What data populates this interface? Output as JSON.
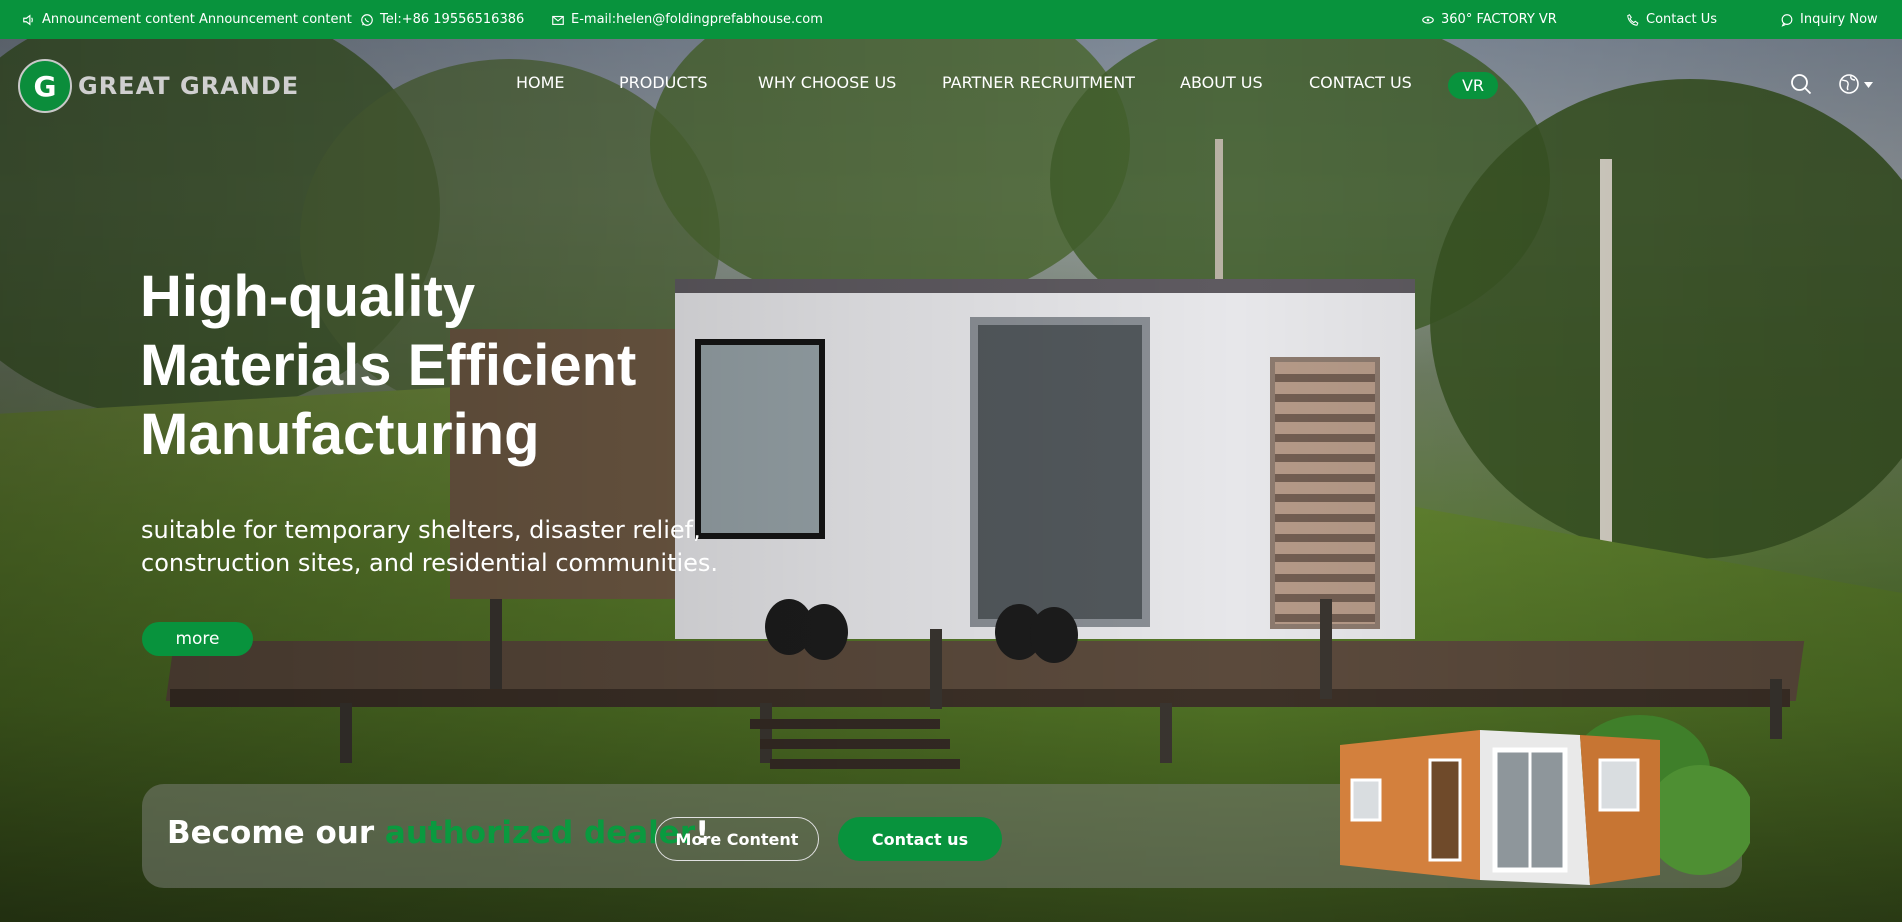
{
  "topbar": {
    "announcement": "Announcement content Announcement content",
    "tel": "Tel:+86 19556516386",
    "email": "E-mail:helen@foldingprefabhouse.com",
    "vr": "360° FACTORY VR",
    "contact": "Contact Us",
    "inquiry": "Inquiry Now"
  },
  "brand": {
    "name": "GREAT GRANDE",
    "mark": "G"
  },
  "nav": {
    "items": [
      "HOME",
      "PRODUCTS",
      "WHY CHOOSE US",
      "PARTNER RECRUITMENT",
      "ABOUT US",
      "CONTACT US"
    ],
    "vr": "VR"
  },
  "hero": {
    "headline_lines": [
      "High-quality",
      "Materials Efficient",
      "Manufacturing"
    ],
    "subtitle": "suitable for temporary shelters, disaster relief, construction sites, and residential communities.",
    "more": "more"
  },
  "dealer": {
    "prefix": "Become our ",
    "highlight": "authorized dealer",
    "suffix": "!",
    "more_content": "More Content",
    "contact": "Contact us"
  },
  "colors": {
    "brand_green": "#08933d",
    "highlight_green": "#0a9a3f"
  },
  "icons": [
    "speaker-icon",
    "whatsapp-icon",
    "mail-icon",
    "vr-eye-icon",
    "phone-icon",
    "chat-icon",
    "search-icon",
    "globe-icon",
    "caret-down-icon"
  ]
}
